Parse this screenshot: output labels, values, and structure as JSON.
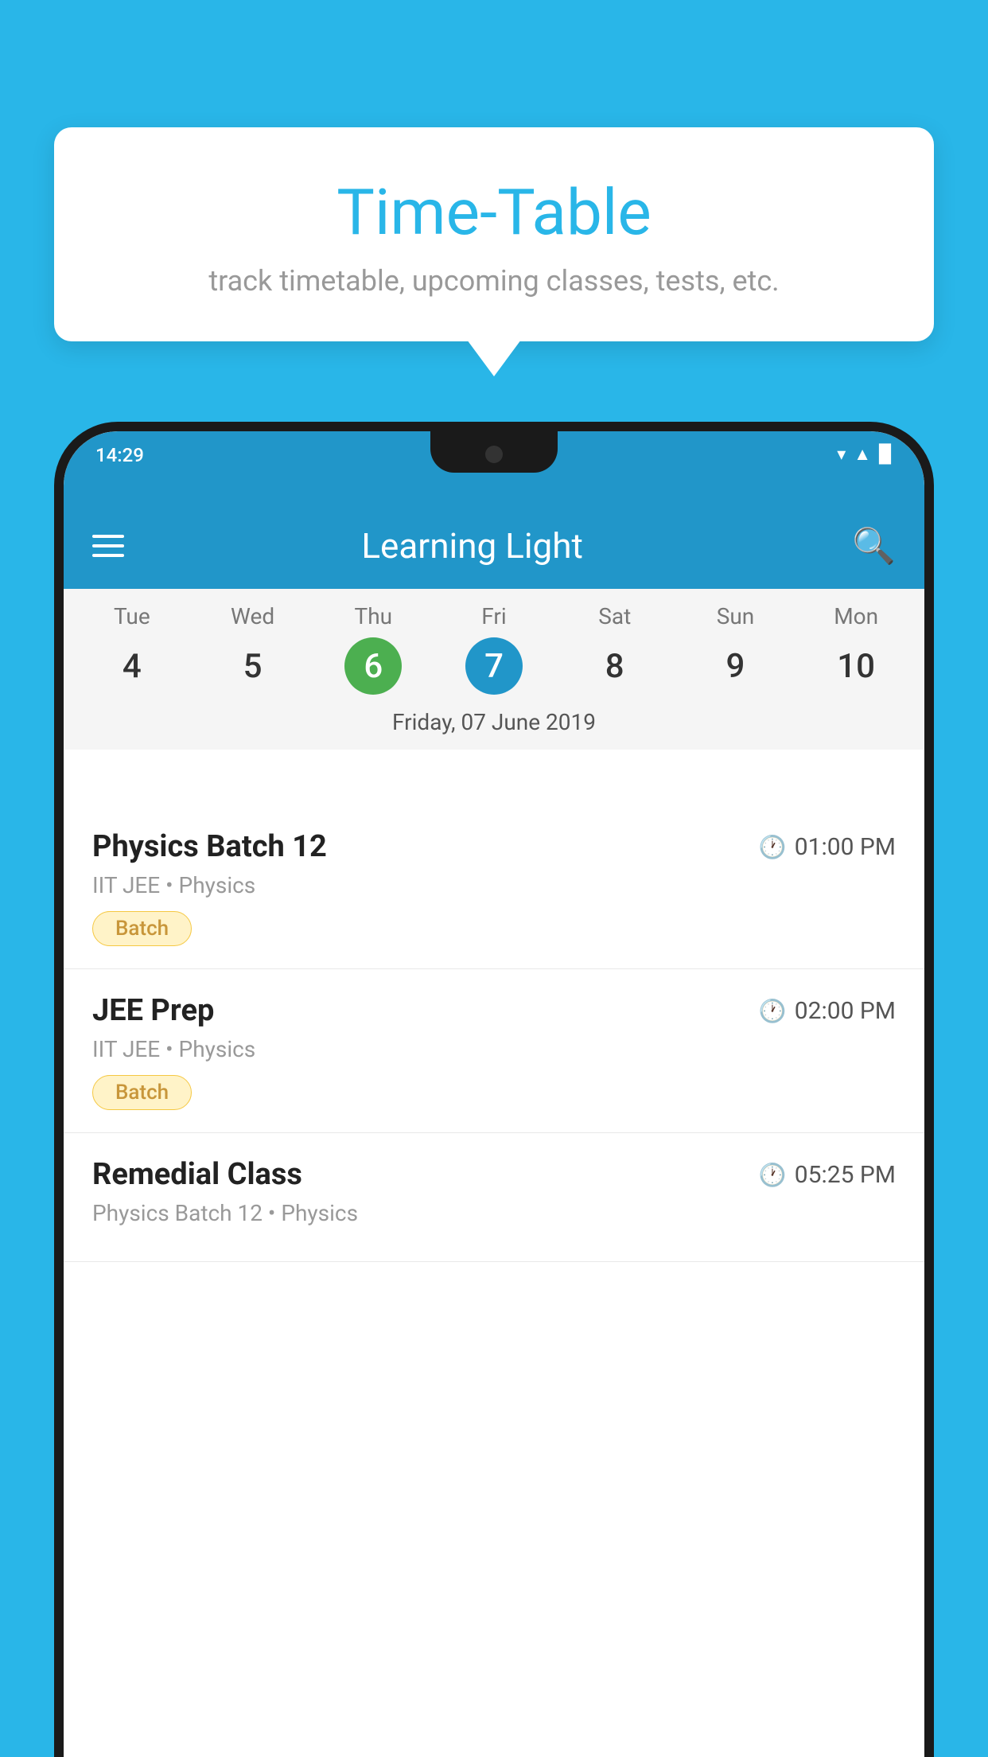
{
  "page": {
    "background_color": "#29B6E8"
  },
  "tooltip": {
    "title": "Time-Table",
    "subtitle": "track timetable, upcoming classes, tests, etc."
  },
  "status_bar": {
    "time": "14:29"
  },
  "app_bar": {
    "title": "Learning Light"
  },
  "calendar": {
    "days": [
      {
        "name": "Tue",
        "num": "4",
        "state": "normal"
      },
      {
        "name": "Wed",
        "num": "5",
        "state": "normal"
      },
      {
        "name": "Thu",
        "num": "6",
        "state": "today"
      },
      {
        "name": "Fri",
        "num": "7",
        "state": "selected"
      },
      {
        "name": "Sat",
        "num": "8",
        "state": "normal"
      },
      {
        "name": "Sun",
        "num": "9",
        "state": "normal"
      },
      {
        "name": "Mon",
        "num": "10",
        "state": "normal"
      }
    ],
    "selected_date_label": "Friday, 07 June 2019"
  },
  "schedule": {
    "items": [
      {
        "title": "Physics Batch 12",
        "time": "01:00 PM",
        "subtitle": "IIT JEE • Physics",
        "badge": "Batch"
      },
      {
        "title": "JEE Prep",
        "time": "02:00 PM",
        "subtitle": "IIT JEE • Physics",
        "badge": "Batch"
      },
      {
        "title": "Remedial Class",
        "time": "05:25 PM",
        "subtitle": "Physics Batch 12 • Physics",
        "badge": null
      }
    ]
  }
}
